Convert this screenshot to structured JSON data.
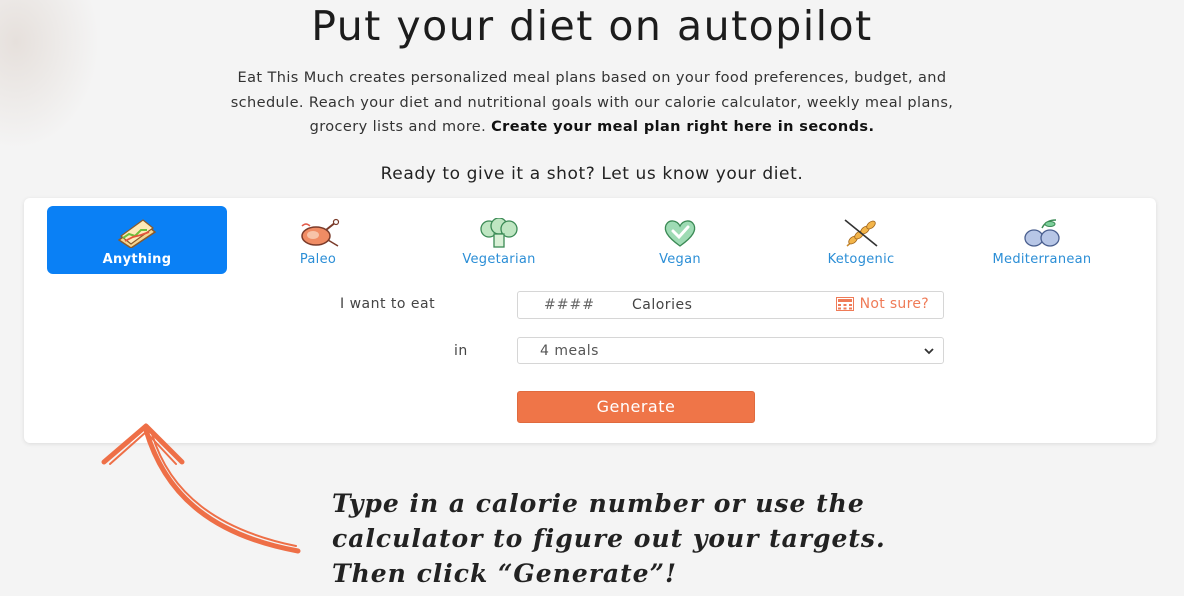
{
  "hero": {
    "title": "Put your diet on autopilot",
    "intro_line1": "Eat This Much creates personalized meal plans based on your food preferences, budget, and",
    "intro_line2": "schedule. Reach your diet and nutritional goals with our calorie calculator, weekly meal plans,",
    "intro_line3": "grocery lists and more.",
    "intro_bold": "Create your meal plan right here in seconds.",
    "prompt": "Ready to give it a shot? Let us know your diet."
  },
  "diets": [
    {
      "label": "Anything",
      "icon": "sandwich-icon",
      "active": true
    },
    {
      "label": "Paleo",
      "icon": "meat-icon",
      "active": false
    },
    {
      "label": "Vegetarian",
      "icon": "broccoli-icon",
      "active": false
    },
    {
      "label": "Vegan",
      "icon": "heart-check-icon",
      "active": false
    },
    {
      "label": "Ketogenic",
      "icon": "no-wheat-icon",
      "active": false
    },
    {
      "label": "Mediterranean",
      "icon": "olives-icon",
      "active": false
    }
  ],
  "form": {
    "eat_label": "I want to eat",
    "calories_placeholder": "####",
    "calories_unit": "Calories",
    "not_sure": "Not sure?",
    "in_label": "in",
    "meals_selected": "4 meals",
    "generate_label": "Generate"
  },
  "annotation": {
    "line1": "Type in a calorie number or use the",
    "line2": "calculator to figure out your targets.",
    "line3": "Then click “Generate”!"
  },
  "colors": {
    "active_tab": "#0a80f5",
    "link_blue": "#2b8ed6",
    "accent_orange": "#ef7548",
    "arrow_orange": "#ee6f47"
  }
}
